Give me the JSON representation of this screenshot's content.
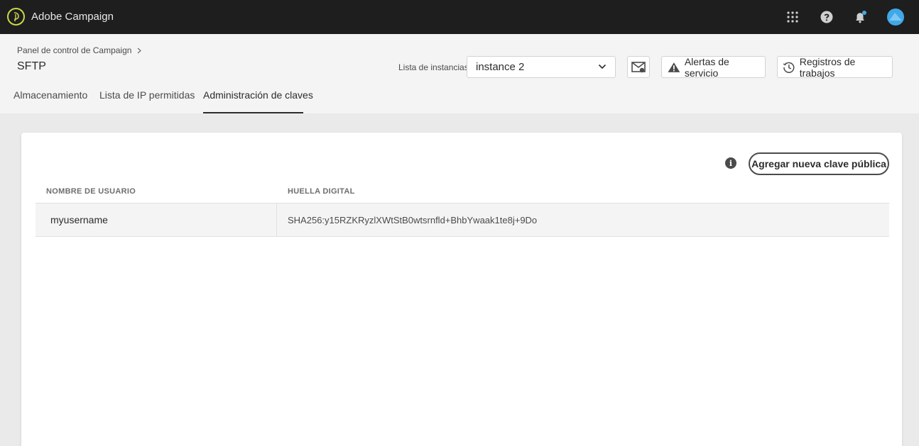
{
  "app": {
    "title": "Adobe Campaign"
  },
  "topbar": {
    "icons": [
      "apps-grid-icon",
      "help-icon",
      "notifications-bell-icon",
      "user-avatar"
    ]
  },
  "header": {
    "breadcrumb": "Panel de control de Campaign",
    "title": "SFTP",
    "instance_label": "Lista de instancias",
    "instance_selected": "instance 2",
    "alerts_button": "Alertas de servicio",
    "logs_button": "Registros de trabajos"
  },
  "tabs": [
    {
      "label": "Almacenamiento",
      "active": false
    },
    {
      "label": "Lista de IP permitidas",
      "active": false
    },
    {
      "label": "Administración de claves",
      "active": true
    }
  ],
  "keys": {
    "add_button": "Agregar nueva clave pública",
    "columns": [
      "NOMBRE DE USUARIO",
      "HUELLA DIGITAL"
    ],
    "rows": [
      {
        "username": "myusername",
        "fingerprint": "SHA256:y15RZKRyzlXWtStB0wtsrnfld+BhbYwaak1te8j+9Do"
      }
    ]
  },
  "colors": {
    "topbar": "#1e1e1e",
    "accent_blue": "#3fa8e8",
    "logo_ring": "#c9d84b"
  }
}
